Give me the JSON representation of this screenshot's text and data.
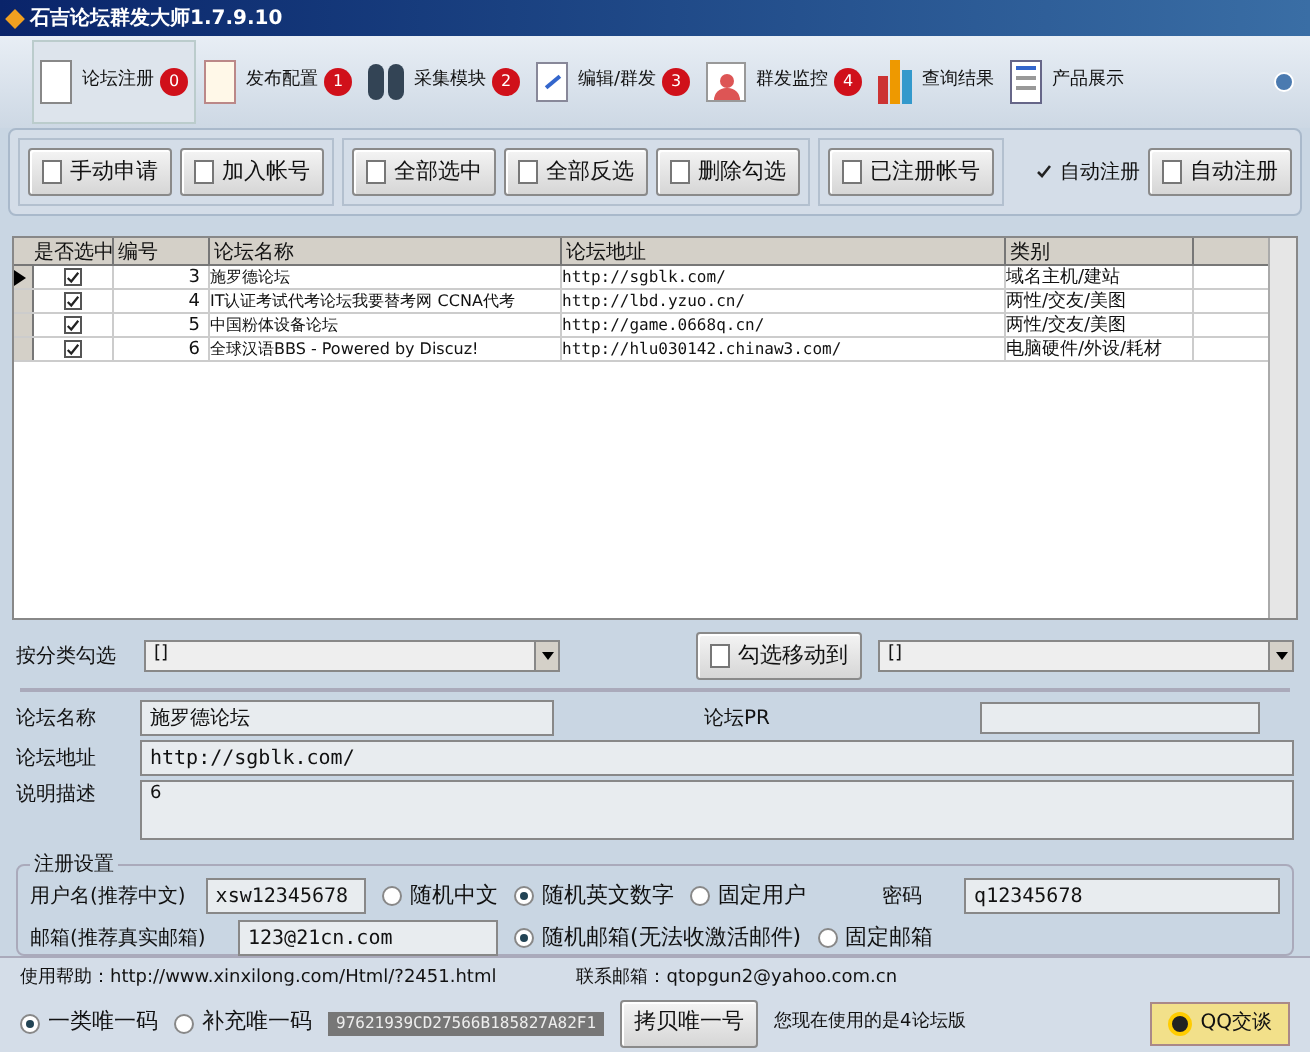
{
  "window": {
    "title": "石吉论坛群发大师1.7.9.10"
  },
  "tabs": [
    {
      "label": "论坛注册",
      "badge": "0",
      "selected": true
    },
    {
      "label": "发布配置",
      "badge": "1",
      "selected": false
    },
    {
      "label": "采集模块",
      "badge": "2",
      "selected": false
    },
    {
      "label": "编辑/群发",
      "badge": "3",
      "selected": false
    },
    {
      "label": "群发监控",
      "badge": "4",
      "selected": false
    },
    {
      "label": "查询结果",
      "selected": false
    },
    {
      "label": "产品展示",
      "selected": false
    }
  ],
  "toolbar": {
    "groups": [
      [
        "手动申请",
        "加入帐号"
      ],
      [
        "全部选中",
        "全部反选",
        "删除勾选"
      ],
      [
        "已注册帐号"
      ]
    ],
    "auto_register": {
      "label": "自动注册",
      "checked": true
    },
    "auto_button": "自动注册"
  },
  "table": {
    "check_column": "是否选中",
    "columns": [
      "编号",
      "论坛名称",
      "论坛地址",
      "类别"
    ],
    "rows": [
      {
        "selected": true,
        "checked": true,
        "cells": [
          "3",
          "施罗德论坛",
          "http://sgblk.com/",
          "域名主机/建站"
        ]
      },
      {
        "selected": false,
        "checked": true,
        "cells": [
          "4",
          "IT认证考试代考论坛我要替考网 CCNA代考",
          "http://lbd.yzuo.cn/",
          "两性/交友/美图"
        ]
      },
      {
        "selected": false,
        "checked": true,
        "cells": [
          "5",
          "中国粉体设备论坛",
          "http://game.0668q.cn/",
          "两性/交友/美图"
        ]
      },
      {
        "selected": false,
        "checked": true,
        "cells": [
          "6",
          "全球汉语BBS  - Powered by Discuz!",
          "http://hlu030142.chinaw3.com/",
          "电脑硬件/外设/耗材"
        ]
      }
    ]
  },
  "filter": {
    "label": "按分类勾选",
    "value": "[]",
    "move_button": "勾选移动到",
    "move_value": "[]"
  },
  "details": {
    "name_label": "论坛名称",
    "name": "施罗德论坛",
    "pr_label": "论坛PR",
    "url_label": "论坛地址",
    "url": "http://sgblk.com/",
    "desc_label": "说明描述",
    "desc": "6"
  },
  "register": {
    "title": "注册设置",
    "user_label": "用户名(推荐中文)",
    "user": "xsw12345678",
    "user_modes": [
      {
        "label": "随机中文",
        "selected": false
      },
      {
        "label": "随机英文数字",
        "selected": true
      },
      {
        "label": "固定用户",
        "selected": false
      }
    ],
    "password_label": "密码",
    "password": "q12345678",
    "email_label": "邮箱(推荐真实邮箱)",
    "email": "123@21cn.com",
    "email_modes": [
      {
        "label": "随机邮箱(无法收激活邮件)",
        "selected": true
      },
      {
        "label": "固定邮箱",
        "selected": false
      }
    ]
  },
  "footer": {
    "help": "使用帮助：http://www.xinxilong.com/Html/?2451.html",
    "contact": "联系邮箱：qtopgun2@yahoo.com.cn",
    "codes": [
      {
        "label": "一类唯一码",
        "selected": true
      },
      {
        "label": "补充唯一码",
        "selected": false
      }
    ],
    "code": "97621939CD27566B185827A82F1",
    "copy_button": "拷贝唯一号",
    "version": "您现在使用的是4论坛版",
    "qq_button": "QQ交谈"
  }
}
